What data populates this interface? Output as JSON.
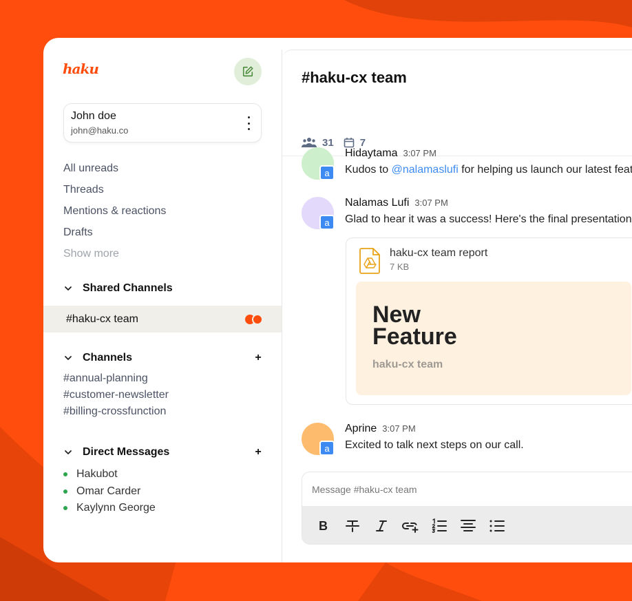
{
  "brand": {
    "logo_text": "haku",
    "accent": "#FF4D0D"
  },
  "sidebar": {
    "compose_icon": "edit-icon",
    "user": {
      "name": "John doe",
      "email": "john@haku.co"
    },
    "nav": [
      {
        "label": "All unreads"
      },
      {
        "label": "Threads"
      },
      {
        "label": "Mentions & reactions"
      },
      {
        "label": "Drafts"
      },
      {
        "label": "Show more"
      }
    ],
    "shared_channels": {
      "title": "Shared Channels",
      "items": [
        {
          "label": "#haku-cx team",
          "active": true
        }
      ]
    },
    "channels": {
      "title": "Channels",
      "add": "+",
      "items": [
        {
          "label": "#annual-planning"
        },
        {
          "label": "#customer-newsletter"
        },
        {
          "label": "#billing-crossfunction"
        }
      ]
    },
    "direct_messages": {
      "title": "Direct Messages",
      "add": "+",
      "items": [
        {
          "label": "Hakubot",
          "status": "online"
        },
        {
          "label": "Omar Carder",
          "status": "online"
        },
        {
          "label": "Kaylynn George",
          "status": "online"
        }
      ]
    }
  },
  "main": {
    "channel_title": "#haku-cx team",
    "stats": {
      "members": "31",
      "events": "7"
    },
    "messages": [
      {
        "author": "Hidaytama",
        "time": "3:07 PM",
        "text_before": "Kudos to ",
        "mention": "@nalamaslufi",
        "text_after": " for helping us launch our latest feature",
        "avatar_color": "#CDEFCB",
        "badge": "a"
      },
      {
        "author": "Nalamas Lufi",
        "time": "3:07 PM",
        "text": "Glad to hear it was a success! Here's the final presentation in",
        "avatar_color": "#E3D9FA",
        "badge": "a",
        "attachment": {
          "file_name": "haku-cx team report",
          "file_size": "7 KB",
          "icon": "google-drive-file-icon",
          "preview_title": "New Feature",
          "preview_subtitle": "haku-cx team"
        }
      },
      {
        "author": "Aprine",
        "time": "3:07 PM",
        "text": "Excited to talk next steps on our call.",
        "avatar_color": "#FDBB6E",
        "badge": "a"
      }
    ],
    "composer": {
      "placeholder": "Message #haku-cx team",
      "tools": [
        "bold-icon",
        "strikethrough-icon",
        "italic-icon",
        "link-icon",
        "numbered-list-icon",
        "align-center-icon",
        "bullet-list-icon"
      ]
    }
  }
}
